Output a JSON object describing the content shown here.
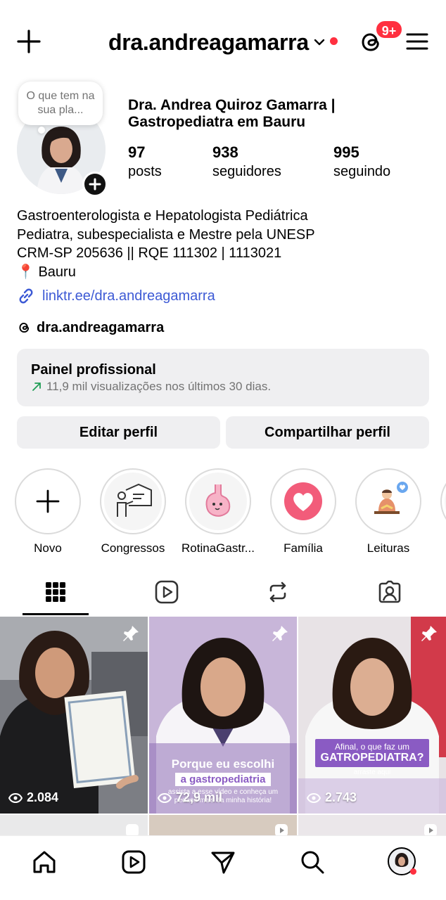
{
  "header": {
    "username": "dra.andreagamarra",
    "notif_badge": "9+",
    "accent": "#ff3040"
  },
  "profile": {
    "note": "O que tem na sua pla...",
    "full_name": "Dra. Andrea Quiroz Gamarra | Gastropediatra em Bauru",
    "stats": [
      {
        "value": "97",
        "label": "posts"
      },
      {
        "value": "938",
        "label": "seguidores"
      },
      {
        "value": "995",
        "label": "seguindo"
      }
    ],
    "bio": [
      "Gastroenterologista e Hepatologista Pediátrica",
      "Pediatra, subespecialista e Mestre pela UNESP",
      "CRM-SP 205636 || RQE 111302 | 1113021",
      "📍 Bauru"
    ],
    "link": "linktr.ee/dra.andreagamarra",
    "threads_handle": "dra.andreagamarra"
  },
  "panel": {
    "title": "Painel profissional",
    "subtitle": "11,9 mil visualizações nos últimos 30 dias."
  },
  "buttons": {
    "edit": "Editar perfil",
    "share": "Compartilhar perfil"
  },
  "highlights": [
    {
      "label": "Novo",
      "icon": "plus-icon"
    },
    {
      "label": "Congressos",
      "icon": "presentation-icon"
    },
    {
      "label": "RotinaGastr...",
      "icon": "stomach-icon"
    },
    {
      "label": "Família",
      "icon": "heart-icon"
    },
    {
      "label": "Leituras",
      "icon": "reading-icon"
    }
  ],
  "tabs": [
    {
      "name": "grid-icon",
      "active": true
    },
    {
      "name": "reels-icon",
      "active": false
    },
    {
      "name": "reposts-icon",
      "active": false
    },
    {
      "name": "tagged-icon",
      "active": false
    }
  ],
  "posts": [
    {
      "views": "2.084",
      "pinned": true
    },
    {
      "views": "72,9 mil",
      "pinned": true,
      "banner_line1": "Porque eu escolhi",
      "banner_line2": "a gastropediatria",
      "banner_line3": "assista a esse vídeo e conheça um pedaço mais da minha história!"
    },
    {
      "views": "2.743",
      "pinned": true,
      "banner_line1": "Afinal, o que faz um",
      "banner_line2": "GATROPEDIATRA?",
      "banner_line3": "arraste aqui"
    }
  ],
  "nav": [
    "home-icon",
    "reels-icon",
    "send-icon",
    "search-icon",
    "profile-avatar"
  ]
}
